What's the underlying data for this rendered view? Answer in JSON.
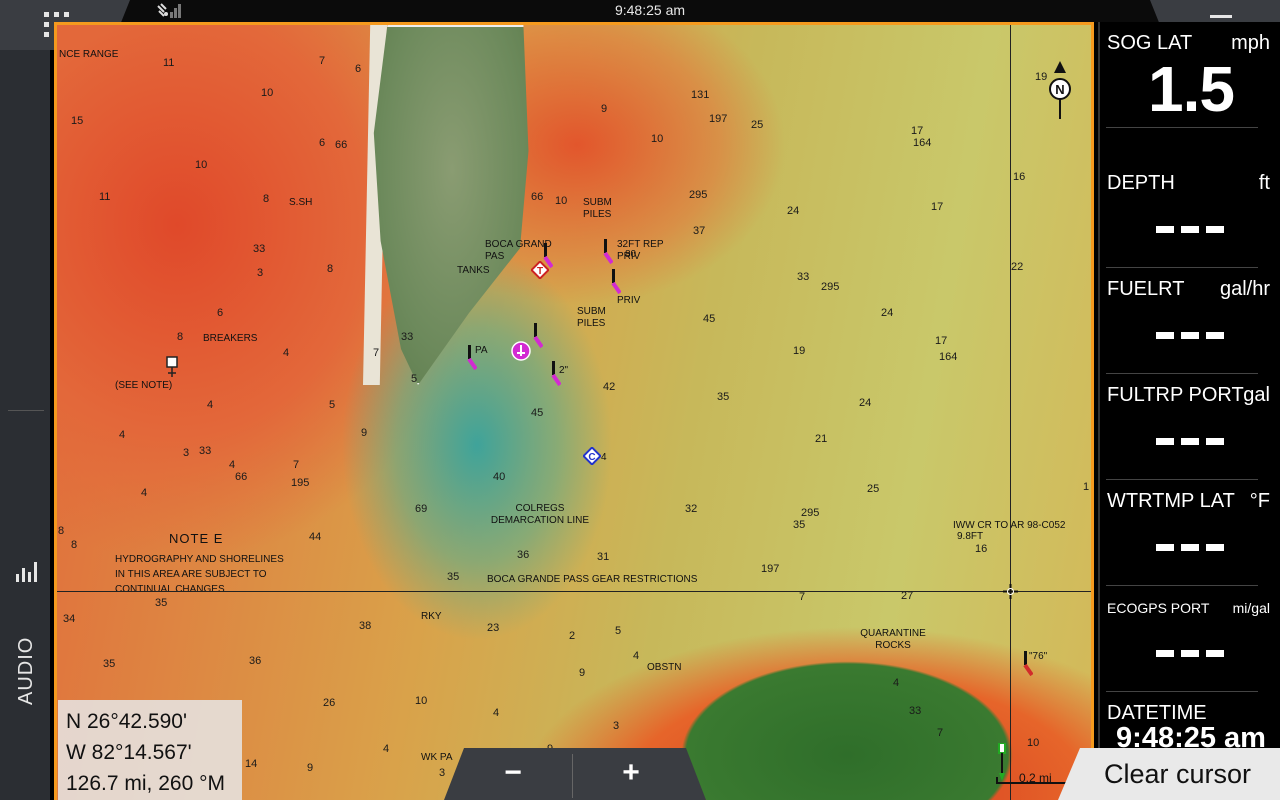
{
  "status_bar": {
    "time": "9:48:25 am"
  },
  "left_strip": {
    "audio_label": "AUDIO"
  },
  "chart": {
    "labels": {
      "range": "NCE RANGE",
      "ssh": "S.SH",
      "breakers": "BREAKERS",
      "see_note": "(SEE NOTE)",
      "boca_grand_pas": "BOCA GRAND PAS",
      "tanks": "TANKS",
      "subm_piles_1": "SUBM PILES",
      "subm_piles_2": "SUBM PILES",
      "rep_priv": "32FT REP PRIV",
      "priv": "PRIV",
      "pa": "PA",
      "colregs": "COLREGS DEMARCATION LINE",
      "gear_restrictions": "BOCA GRANDE PASS GEAR RESTRICTIONS",
      "rky": "RKY",
      "obstn": "OBSTN",
      "quarantine": "QUARANTINE ROCKS",
      "iww": "IWW CR TO AR 98-C052",
      "iww_depth": "9.8FT",
      "wk_pa": "WK PA",
      "marker_76": "\"76\"",
      "marker_2": "2\"",
      "marker_4": "4",
      "marker_80": "80"
    },
    "note_title": "NOTE E",
    "note_lines": [
      "HYDROGRAPHY AND SHORELINES",
      "IN THIS AREA ARE SUBJECT TO",
      "CONTINUAL CHANGES"
    ],
    "depths": [
      {
        "v": "11",
        "c": "d1"
      },
      {
        "v": "7",
        "c": "d2"
      },
      {
        "v": "6",
        "c": "d3"
      },
      {
        "v": "10",
        "c": "d4"
      },
      {
        "v": "15",
        "c": "d5"
      },
      {
        "v": "10",
        "c": "d6"
      },
      {
        "v": "11",
        "c": "d7"
      },
      {
        "v": "8",
        "c": "d8"
      },
      {
        "v": "6",
        "c": "d9"
      },
      {
        "v": "66",
        "c": "d10"
      },
      {
        "v": "33",
        "c": "d11"
      },
      {
        "v": "3",
        "c": "d12"
      },
      {
        "v": "8",
        "c": "d13"
      },
      {
        "v": "6",
        "c": "d14"
      },
      {
        "v": "8",
        "c": "d15"
      },
      {
        "v": "4",
        "c": "d16"
      },
      {
        "v": "7",
        "c": "d17"
      },
      {
        "v": "33",
        "c": "d18"
      },
      {
        "v": "5",
        "c": "d19"
      },
      {
        "v": "4",
        "c": "d20"
      },
      {
        "v": "5",
        "c": "d21"
      },
      {
        "v": "9",
        "c": "d22"
      },
      {
        "v": "4",
        "c": "d23"
      },
      {
        "v": "3",
        "c": "d24"
      },
      {
        "v": "33",
        "c": "d25"
      },
      {
        "v": "4",
        "c": "d26"
      },
      {
        "v": "66",
        "c": "d27"
      },
      {
        "v": "7",
        "c": "d28"
      },
      {
        "v": "195",
        "c": "d29"
      },
      {
        "v": "4",
        "c": "d30"
      },
      {
        "v": "8",
        "c": "d31"
      },
      {
        "v": "9",
        "c": "d32"
      },
      {
        "v": "10",
        "c": "d33"
      },
      {
        "v": "131",
        "c": "d34"
      },
      {
        "v": "197",
        "c": "d35"
      },
      {
        "v": "25",
        "c": "d36"
      },
      {
        "v": "66",
        "c": "d37"
      },
      {
        "v": "10",
        "c": "d38"
      },
      {
        "v": "295",
        "c": "d39"
      },
      {
        "v": "37",
        "c": "d40"
      },
      {
        "v": "24",
        "c": "d41"
      },
      {
        "v": "33",
        "c": "d42"
      },
      {
        "v": "295",
        "c": "d43"
      },
      {
        "v": "45",
        "c": "d44"
      },
      {
        "v": "19",
        "c": "d45"
      },
      {
        "v": "42",
        "c": "d46"
      },
      {
        "v": "45",
        "c": "d47"
      },
      {
        "v": "35",
        "c": "d48"
      },
      {
        "v": "21",
        "c": "d49"
      },
      {
        "v": "40",
        "c": "d50"
      },
      {
        "v": "69",
        "c": "d51"
      },
      {
        "v": "32",
        "c": "d52"
      },
      {
        "v": "295",
        "c": "d53"
      },
      {
        "v": "35",
        "c": "d54"
      },
      {
        "v": "44",
        "c": "d55"
      },
      {
        "v": "36",
        "c": "d56"
      },
      {
        "v": "31",
        "c": "d57"
      },
      {
        "v": "35",
        "c": "d58"
      },
      {
        "v": "197",
        "c": "d59"
      },
      {
        "v": "35",
        "c": "d60"
      },
      {
        "v": "34",
        "c": "d61"
      },
      {
        "v": "38",
        "c": "d62"
      },
      {
        "v": "23",
        "c": "d63"
      },
      {
        "v": "2",
        "c": "d64"
      },
      {
        "v": "5",
        "c": "d65"
      },
      {
        "v": "4",
        "c": "d66"
      },
      {
        "v": "9",
        "c": "d67"
      },
      {
        "v": "35",
        "c": "d68"
      },
      {
        "v": "36",
        "c": "d69"
      },
      {
        "v": "26",
        "c": "d70"
      },
      {
        "v": "10",
        "c": "d71"
      },
      {
        "v": "4",
        "c": "d72"
      },
      {
        "v": "3",
        "c": "d73"
      },
      {
        "v": "4",
        "c": "d74"
      },
      {
        "v": "9",
        "c": "d75"
      },
      {
        "v": "14",
        "c": "d76"
      },
      {
        "v": "9",
        "c": "d77"
      },
      {
        "v": "3",
        "c": "d78"
      },
      {
        "v": "7",
        "c": "d79"
      },
      {
        "v": "27",
        "c": "d80"
      },
      {
        "v": "4",
        "c": "d81"
      },
      {
        "v": "33",
        "c": "d82"
      },
      {
        "v": "7",
        "c": "d83"
      },
      {
        "v": "10",
        "c": "d84"
      },
      {
        "v": "19",
        "c": "d85"
      },
      {
        "v": "17",
        "c": "d86"
      },
      {
        "v": "164",
        "c": "d87"
      },
      {
        "v": "16",
        "c": "d88"
      },
      {
        "v": "17",
        "c": "d89"
      },
      {
        "v": "22",
        "c": "d90"
      },
      {
        "v": "24",
        "c": "d91"
      },
      {
        "v": "17",
        "c": "d92"
      },
      {
        "v": "164",
        "c": "d93"
      },
      {
        "v": "24",
        "c": "d94"
      },
      {
        "v": "25",
        "c": "d95"
      },
      {
        "v": "1",
        "c": "d96"
      },
      {
        "v": "16",
        "c": "d97"
      },
      {
        "v": "8",
        "c": "d98"
      }
    ],
    "north_label": "N",
    "scale_label": "0.2 mi"
  },
  "cursor_info": {
    "lat": "N  26°42.590'",
    "lon": "W  82°14.567'",
    "range_bearing": "126.7 mi, 260 °M"
  },
  "zoom": {
    "minus": "−",
    "plus": "+"
  },
  "clear_cursor": "Clear cursor",
  "panel": {
    "tiles": [
      {
        "name": "SOG LAT",
        "unit": "mph",
        "value": "1.5"
      },
      {
        "name": "DEPTH",
        "unit": "ft"
      },
      {
        "name": "FUELRT",
        "unit": "gal/hr"
      },
      {
        "name": "FULTRP PORT",
        "unit": "gal"
      },
      {
        "name": "WTRTMP LAT",
        "unit": "°F"
      },
      {
        "name": "ECOGPS PORT",
        "unit": "mi/gal"
      },
      {
        "name": "DATETIME",
        "value": "9:48:25 am"
      }
    ]
  },
  "colors": {
    "accent": "#f59a1e",
    "panel_bg": "#000000",
    "tab_bg": "#3a3d42"
  }
}
